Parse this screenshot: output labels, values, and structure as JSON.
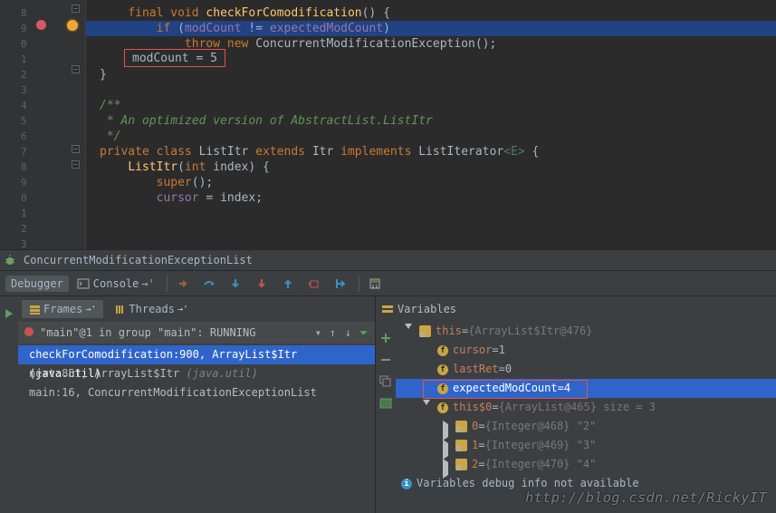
{
  "editor": {
    "line_numbers": [
      "8",
      "9",
      "0",
      "1",
      "2",
      "3",
      "4",
      "5",
      "6",
      "7",
      "8",
      "9",
      "0",
      "1",
      "2",
      "3"
    ],
    "lines": [
      {
        "indent": "    ",
        "tokens": [
          {
            "t": "final ",
            "c": "kw"
          },
          {
            "t": "void ",
            "c": "kw"
          },
          {
            "t": "checkForComodification",
            "c": "method"
          },
          {
            "t": "() {",
            "c": "paren"
          }
        ]
      },
      {
        "indent": "        ",
        "hl": true,
        "tokens": [
          {
            "t": "if ",
            "c": "kw"
          },
          {
            "t": "(",
            "c": "paren"
          },
          {
            "t": "modCount",
            "c": "field"
          },
          {
            "t": " != ",
            "c": "paren"
          },
          {
            "t": "expectedModCount",
            "c": "field"
          },
          {
            "t": ")",
            "c": "paren"
          }
        ]
      },
      {
        "indent": "            ",
        "tokens": [
          {
            "t": "throw new ",
            "c": "kw"
          },
          {
            "t": "ConcurrentModificationException();",
            "c": "paren"
          }
        ]
      },
      {
        "indent": "    ",
        "tokens": [
          {
            "t": "}",
            "c": "paren"
          }
        ],
        "tooltip": "modCount = 5"
      },
      {
        "indent": "",
        "tokens": [
          {
            "t": "}",
            "c": "paren"
          }
        ]
      },
      {
        "indent": "",
        "tokens": [
          {
            "t": " ",
            "c": ""
          }
        ]
      },
      {
        "indent": "",
        "tokens": [
          {
            "t": "/**",
            "c": "comment"
          }
        ]
      },
      {
        "indent": "",
        "tokens": [
          {
            "t": " * An optimized version of AbstractList.ListItr",
            "c": "comment"
          }
        ]
      },
      {
        "indent": "",
        "tokens": [
          {
            "t": " */",
            "c": "comment"
          }
        ]
      },
      {
        "indent": "",
        "tokens": [
          {
            "t": "private class ",
            "c": "kw"
          },
          {
            "t": "ListItr ",
            "c": "paren"
          },
          {
            "t": "extends ",
            "c": "kw"
          },
          {
            "t": "Itr ",
            "c": "paren"
          },
          {
            "t": "implements ",
            "c": "kw"
          },
          {
            "t": "ListIterator",
            "c": "paren"
          },
          {
            "t": "<E>",
            "c": "generic"
          },
          {
            "t": " {",
            "c": "paren"
          }
        ]
      },
      {
        "indent": "    ",
        "tokens": [
          {
            "t": "ListItr",
            "c": "method"
          },
          {
            "t": "(",
            "c": "paren"
          },
          {
            "t": "int ",
            "c": "kw"
          },
          {
            "t": "index) {",
            "c": "paren"
          }
        ]
      },
      {
        "indent": "        ",
        "tokens": [
          {
            "t": "super",
            "c": "kw"
          },
          {
            "t": "();",
            "c": "paren"
          }
        ]
      },
      {
        "indent": "        ",
        "tokens": [
          {
            "t": "cursor",
            "c": "field"
          },
          {
            "t": " = index;",
            "c": "paren"
          }
        ]
      }
    ],
    "tooltip_value": "modCount = 5"
  },
  "debug_tab": {
    "label": "ConcurrentModificationExceptionList"
  },
  "toolbar": {
    "debugger": "Debugger",
    "console": "Console"
  },
  "sub_tabs": {
    "frames": "Frames",
    "threads": "Threads"
  },
  "thread_bar": {
    "text": "\"main\"@1 in group \"main\": RUNNING"
  },
  "frames": [
    {
      "text": "checkForComodification:900, ArrayList$Itr ",
      "suffix": "(java.util)",
      "sel": true
    },
    {
      "text": "next:851, ArrayList$Itr ",
      "suffix": "(java.util)",
      "sel": false
    },
    {
      "text": "main:16, ConcurrentModificationExceptionList",
      "suffix": "",
      "sel": false
    }
  ],
  "variables": {
    "header": "Variables",
    "rows": [
      {
        "lvl": 0,
        "expand": "down",
        "icon": "obj-y",
        "label": "this",
        "eq": " = ",
        "val": "{ArrayList$Itr@476}",
        "valc": "faded2"
      },
      {
        "lvl": 1,
        "icon": "obj-f",
        "iconText": "f",
        "label": "cursor",
        "eq": " = ",
        "val": "1"
      },
      {
        "lvl": 1,
        "icon": "obj-f",
        "iconText": "f",
        "label": "lastRet",
        "eq": " = ",
        "val": "0"
      },
      {
        "lvl": 1,
        "icon": "obj-f",
        "iconText": "f",
        "label": "expectedModCount",
        "eq": " = ",
        "val": "4",
        "sel": true,
        "hlbox": true
      },
      {
        "lvl": 1,
        "expand": "down",
        "icon": "obj-f",
        "iconText": "f",
        "label": "this$0",
        "eq": " = ",
        "val": "{ArrayList@465}  size = 3",
        "valc": "faded2"
      },
      {
        "lvl": 2,
        "expand": "right",
        "icon": "obj-y",
        "label": "0",
        "eq": " = ",
        "val": "{Integer@468} \"2\"",
        "valc": "faded2"
      },
      {
        "lvl": 2,
        "expand": "right",
        "icon": "obj-y",
        "label": "1",
        "eq": " = ",
        "val": "{Integer@469} \"3\"",
        "valc": "faded2"
      },
      {
        "lvl": 2,
        "expand": "right",
        "icon": "obj-y",
        "label": "2",
        "eq": " = ",
        "val": "{Integer@470} \"4\"",
        "valc": "faded2"
      }
    ],
    "info": "Variables debug info not available"
  },
  "watermark": "http://blog.csdn.net/RickyIT"
}
